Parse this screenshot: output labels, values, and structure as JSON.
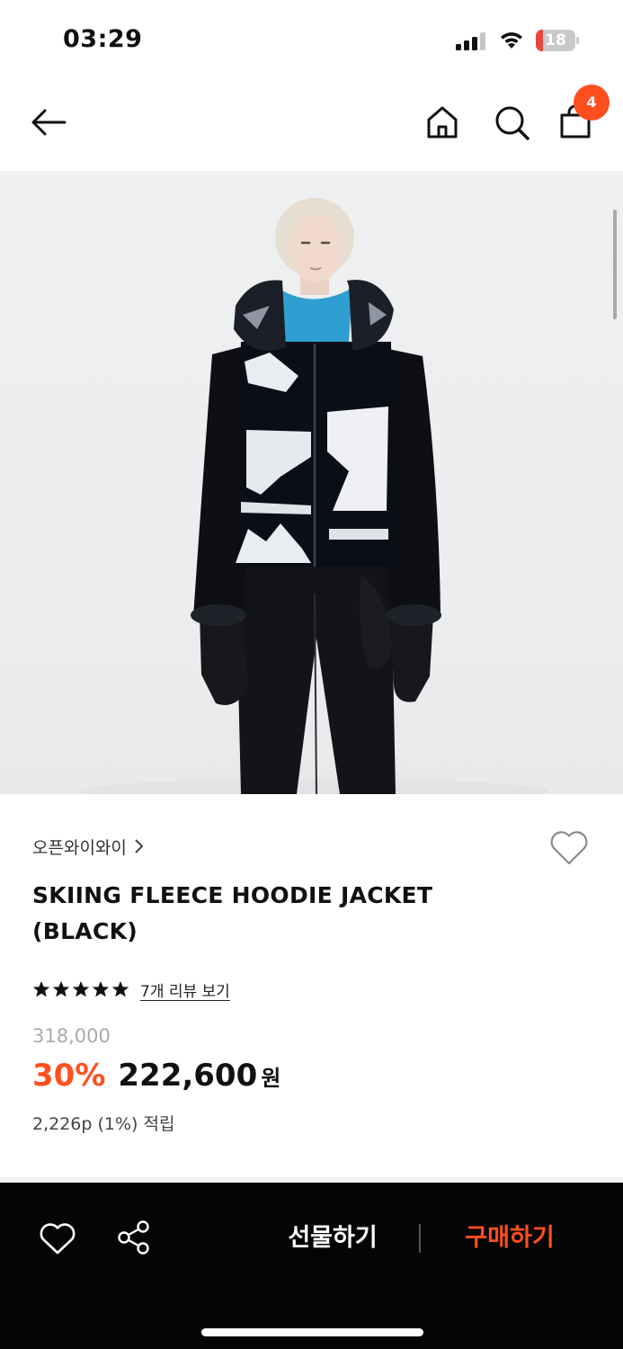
{
  "status_bar": {
    "time": "03:29",
    "battery_level": "18",
    "battery_fraction": 0.18,
    "battery_color": "#e8463f",
    "icons": [
      "signal-icon",
      "wifi-icon",
      "battery-icon"
    ]
  },
  "nav": {
    "icons": [
      "back-arrow-icon",
      "home-icon",
      "search-icon",
      "shopping-bag-icon"
    ],
    "bag_count": "4",
    "badge_color": "#ff4f1f"
  },
  "product": {
    "brand": "오픈와이와이",
    "title_line1": "SKIING FLEECE HOODIE JACKET",
    "title_line2": "(BLACK)",
    "rating_stars": 5,
    "review_link": "7개 리뷰 보기",
    "original_price": "318,000",
    "discount": "30%",
    "sale_price": "222,600",
    "currency": "원",
    "points": "2,226p (1%) 적립",
    "accent_color": "#ff4f1f",
    "image_icon": "product-photo"
  },
  "bottom_bar": {
    "gift_label": "선물하기",
    "buy_label": "구매하기",
    "icons": [
      "heart-icon",
      "share-icon"
    ]
  }
}
